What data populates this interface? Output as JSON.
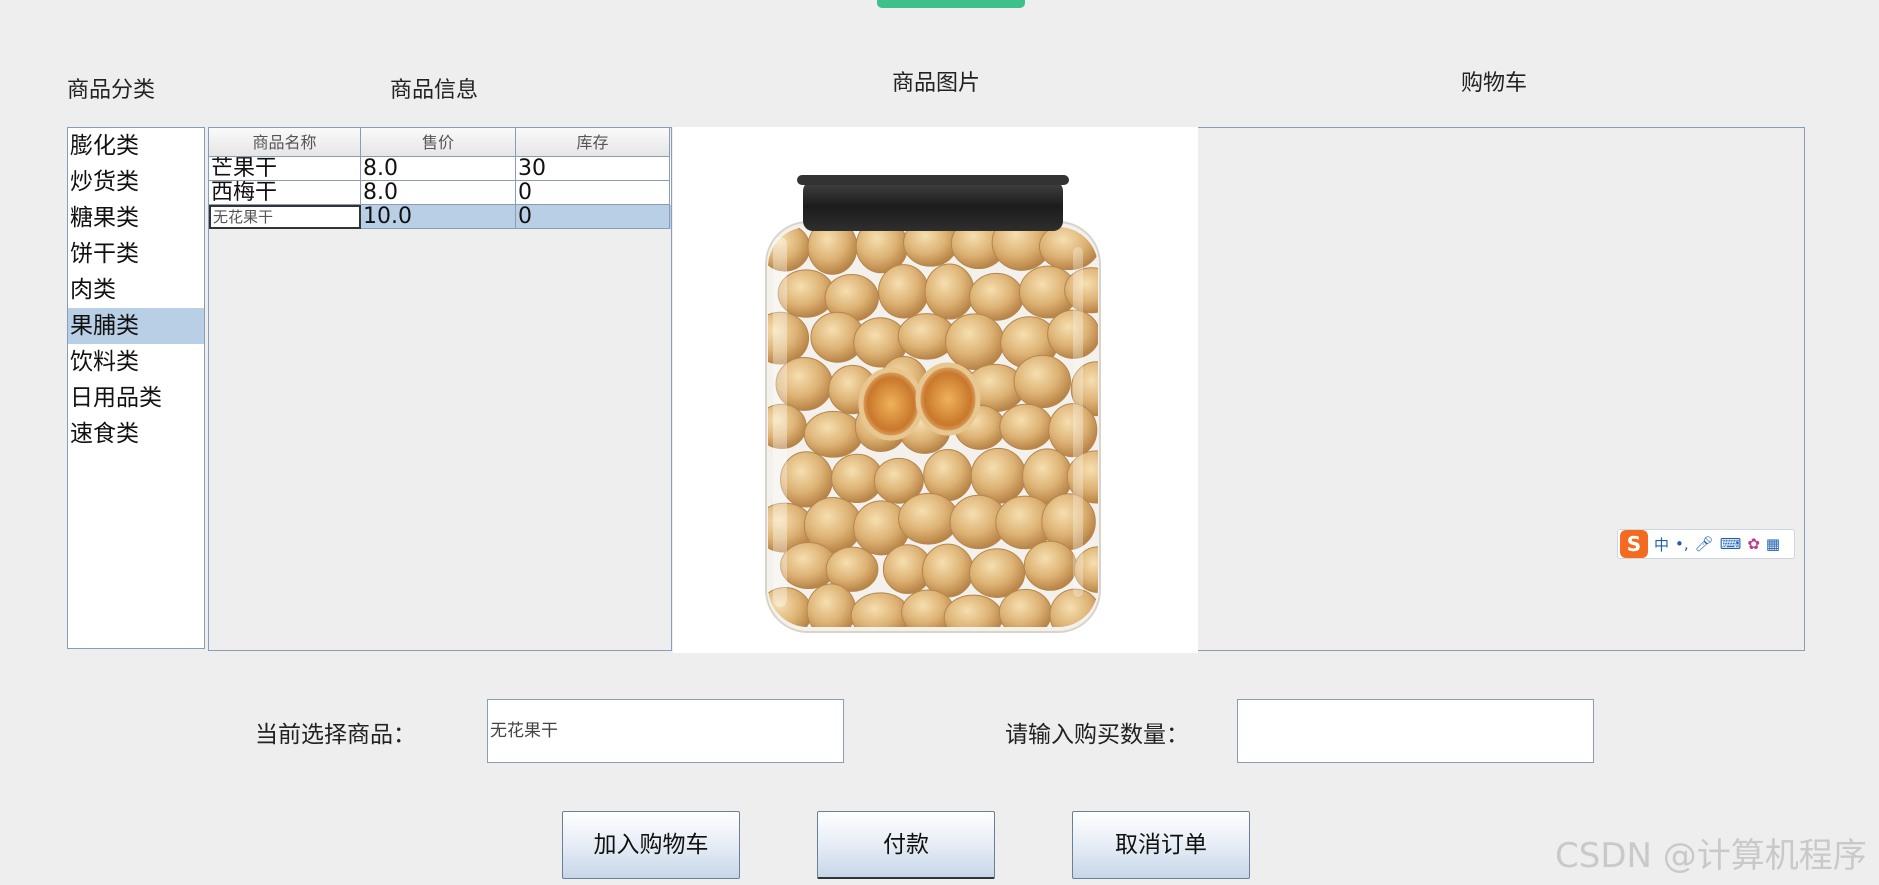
{
  "headers": {
    "category": "商品分类",
    "info": "商品信息",
    "image": "商品图片",
    "cart": "购物车"
  },
  "categories": [
    "膨化类",
    "炒货类",
    "糖果类",
    "饼干类",
    "肉类",
    "果脯类",
    "饮料类",
    "日用品类",
    "速食类"
  ],
  "selected_category": "果脯类",
  "table": {
    "columns": [
      "商品名称",
      "售价",
      "库存"
    ],
    "rows": [
      [
        "芒果干",
        "8.0",
        "30"
      ],
      [
        "西梅干",
        "8.0",
        "0"
      ],
      [
        "无花果干",
        "10.0",
        "0"
      ]
    ],
    "selected_row": 2
  },
  "product_image": {
    "icon": "dried-fig-jar-image"
  },
  "ime": {
    "label": "中",
    "icons": [
      "sogou-logo-icon",
      "punctuation-icon",
      "microphone-icon",
      "keyboard-icon",
      "skin-icon",
      "apps-grid-icon"
    ]
  },
  "form": {
    "current_label": "当前选择商品：",
    "current_value": "无花果干",
    "quantity_label": "请输入购买数量：",
    "quantity_value": ""
  },
  "buttons": {
    "add_to_cart": "加入购物车",
    "pay": "付款",
    "cancel": "取消订单"
  },
  "watermark": "CSDN @计算机程序",
  "colors": {
    "selection": "#b8cfe5",
    "border": "#8a9db8",
    "top_button": "#3ec08a"
  }
}
